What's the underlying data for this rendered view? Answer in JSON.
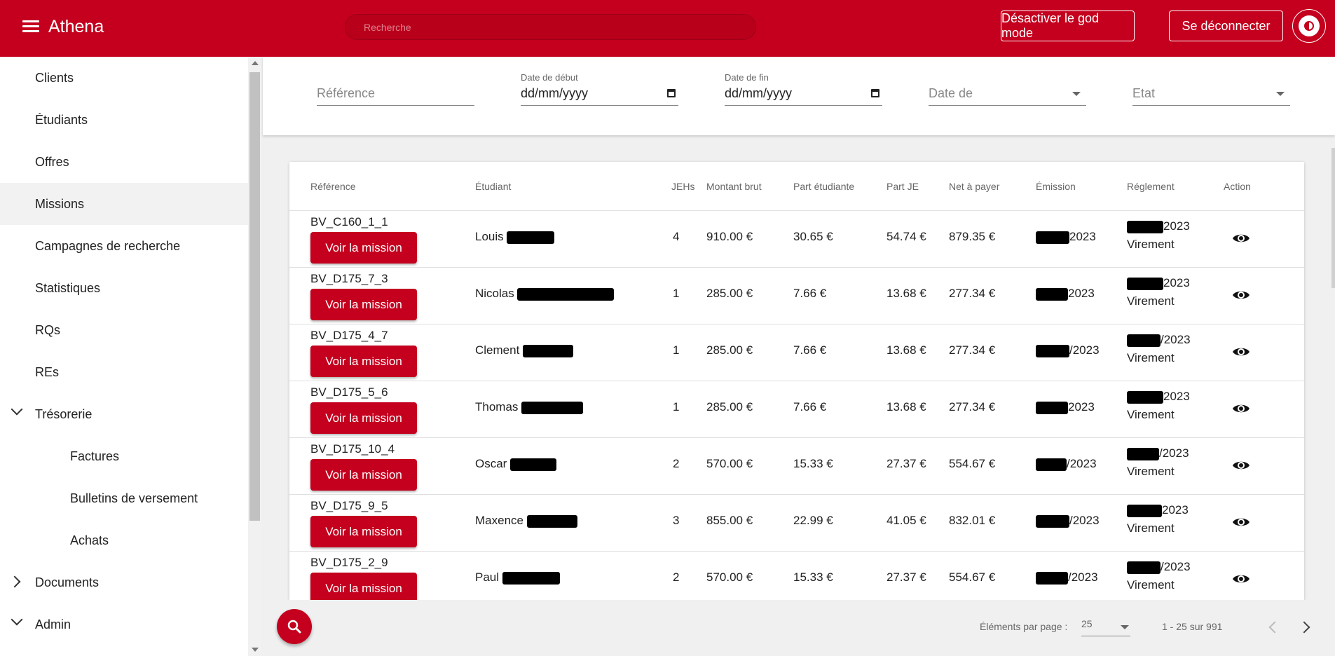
{
  "topbar": {
    "title": "Athena",
    "search_placeholder": "Recherche",
    "god_mode_label": "Désactiver le god mode",
    "logout_label": "Se déconnecter"
  },
  "sidebar": {
    "items": [
      {
        "label": "Clients"
      },
      {
        "label": "Étudiants"
      },
      {
        "label": "Offres"
      },
      {
        "label": "Missions"
      },
      {
        "label": "Campagnes de recherche"
      },
      {
        "label": "Statistiques"
      },
      {
        "label": "RQs"
      },
      {
        "label": "REs"
      },
      {
        "label": "Trésorerie"
      },
      {
        "label": "Factures"
      },
      {
        "label": "Bulletins de versement"
      },
      {
        "label": "Achats"
      },
      {
        "label": "Documents"
      },
      {
        "label": "Admin"
      }
    ]
  },
  "filters": {
    "reference_placeholder": "Référence",
    "date_debut_label": "Date de début",
    "date_debut_value": "dd/mm/yyyy",
    "date_fin_label": "Date de fin",
    "date_fin_value": "dd/mm/yyyy",
    "date_de_placeholder": "Date de",
    "etat_placeholder": "Etat"
  },
  "table": {
    "headers": [
      "Référence",
      "Étudiant",
      "JEHs",
      "Montant brut",
      "Part étudiante",
      "Part JE",
      "Net à payer",
      "Émission",
      "Réglement",
      "Action"
    ],
    "button_label": "Voir la mission",
    "rows": [
      {
        "ref": "BV_C160_1_1",
        "student": "Louis",
        "jehs": "4",
        "brut": "910.00 €",
        "part_etu": "30.65 €",
        "part_je": "54.74 €",
        "net": "879.35 €",
        "emission": "2023",
        "reglement_date": "2023",
        "reglement_mode": "Virement"
      },
      {
        "ref": "BV_D175_7_3",
        "student": "Nicolas",
        "jehs": "1",
        "brut": "285.00 €",
        "part_etu": "7.66 €",
        "part_je": "13.68 €",
        "net": "277.34 €",
        "emission": "2023",
        "reglement_date": "2023",
        "reglement_mode": "Virement"
      },
      {
        "ref": "BV_D175_4_7",
        "student": "Clement",
        "jehs": "1",
        "brut": "285.00 €",
        "part_etu": "7.66 €",
        "part_je": "13.68 €",
        "net": "277.34 €",
        "emission": "/2023",
        "reglement_date": "/2023",
        "reglement_mode": "Virement"
      },
      {
        "ref": "BV_D175_5_6",
        "student": "Thomas",
        "jehs": "1",
        "brut": "285.00 €",
        "part_etu": "7.66 €",
        "part_je": "13.68 €",
        "net": "277.34 €",
        "emission": "2023",
        "reglement_date": "2023",
        "reglement_mode": "Virement"
      },
      {
        "ref": "BV_D175_10_4",
        "student": "Oscar",
        "jehs": "2",
        "brut": "570.00 €",
        "part_etu": "15.33 €",
        "part_je": "27.37 €",
        "net": "554.67 €",
        "emission": "/2023",
        "reglement_date": "/2023",
        "reglement_mode": "Virement"
      },
      {
        "ref": "BV_D175_9_5",
        "student": "Maxence",
        "jehs": "3",
        "brut": "855.00 €",
        "part_etu": "22.99 €",
        "part_je": "41.05 €",
        "net": "832.01 €",
        "emission": "/2023",
        "reglement_date": "2023",
        "reglement_mode": "Virement"
      },
      {
        "ref": "BV_D175_2_9",
        "student": "Paul",
        "jehs": "2",
        "brut": "570.00 €",
        "part_etu": "15.33 €",
        "part_je": "27.37 €",
        "net": "554.67 €",
        "emission": "/2023",
        "reglement_date": "/2023",
        "reglement_mode": "Virement"
      }
    ]
  },
  "pagination": {
    "per_page_label": "Éléments par page :",
    "per_page_value": "25",
    "range": "1 - 25 sur 991"
  },
  "colors": {
    "primary": "#c4001e"
  }
}
